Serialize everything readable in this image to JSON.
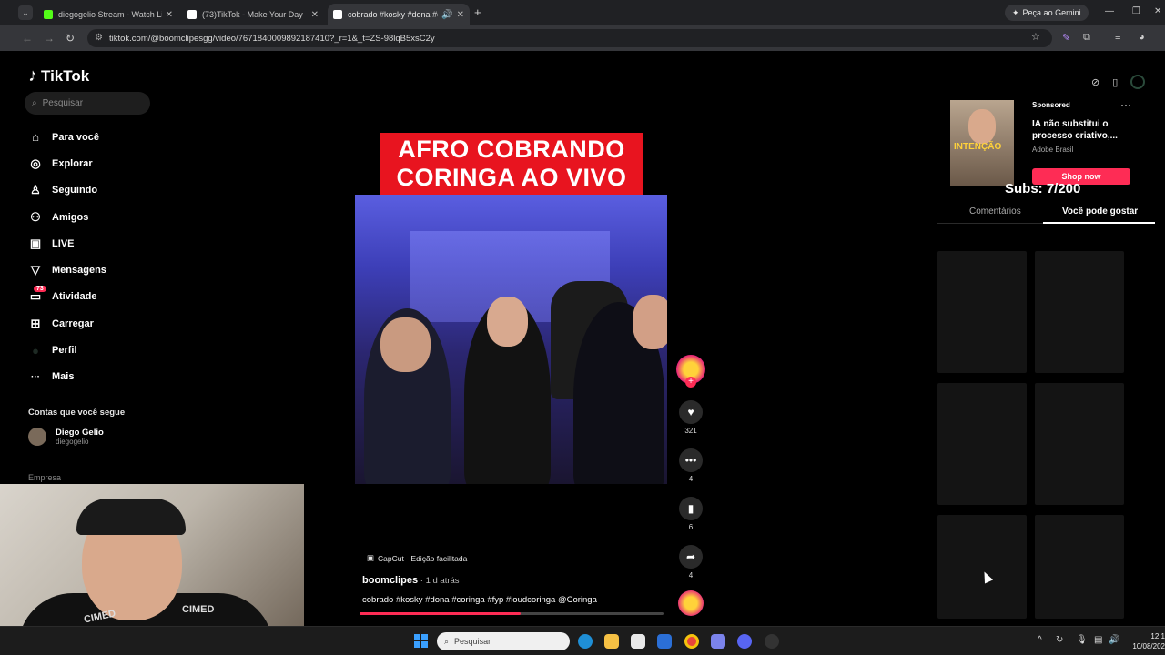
{
  "browser": {
    "tabs": [
      {
        "label": "diegogelio Stream - Watch Live",
        "color": "#53fc18"
      },
      {
        "label": "(73)TikTok - Make Your Day",
        "color": "#ffffff"
      },
      {
        "label": "cobrado #kosky #dona #co",
        "color": "#ffffff"
      }
    ],
    "gemini_label": "Peça ao Gemini",
    "url": "tiktok.com/@boomclipesgg/video/7671840009892187410?_r=1&_t=ZS-98lqB5xsC2y"
  },
  "sidebar": {
    "logo_text": "TikTok",
    "search_placeholder": "Pesquisar",
    "nav": [
      {
        "label": "Para você",
        "icon": "home-icon",
        "glyph": "⌂"
      },
      {
        "label": "Explorar",
        "icon": "compass-icon",
        "glyph": "◎"
      },
      {
        "label": "Seguindo",
        "icon": "following-icon",
        "glyph": "♙"
      },
      {
        "label": "Amigos",
        "icon": "friends-icon",
        "glyph": "⚇"
      },
      {
        "label": "LIVE",
        "icon": "live-icon",
        "glyph": "▣"
      },
      {
        "label": "Mensagens",
        "icon": "messages-icon",
        "glyph": "▽"
      },
      {
        "label": "Atividade",
        "icon": "activity-icon",
        "glyph": "▭",
        "badge": "73"
      },
      {
        "label": "Carregar",
        "icon": "upload-icon",
        "glyph": "⊞"
      },
      {
        "label": "Perfil",
        "icon": "profile-icon",
        "glyph": "●"
      },
      {
        "label": "Mais",
        "icon": "more-icon",
        "glyph": "···"
      }
    ],
    "following_heading": "Contas que você segue",
    "following_account": {
      "name": "Diego Gelio",
      "handle": "diegogelio"
    },
    "company_label": "Empresa"
  },
  "webcam": {
    "shirt_text_left": "CIMED",
    "shirt_text_right": "CIMED"
  },
  "video": {
    "title_line1": "AFRO COBRANDO",
    "title_line2": "CORINGA AO VIVO",
    "capcut_label": "CapCut · Edição facilitada",
    "author": "boomclipes",
    "posted": " · 1 d atrás",
    "description": "cobrado #kosky #dona #coringa #fyp #loudcoringa @Coringa",
    "progress": 0.53
  },
  "actions": {
    "likes": "321",
    "comments": "4",
    "saves": "6",
    "shares": "4"
  },
  "right_panel": {
    "ad": {
      "thumb_tag": "INTENÇÃO",
      "sponsored": "Sponsored",
      "title": "IA não substitui o processo criativo,...",
      "brand": "Adobe Brasil",
      "cta": "Shop now"
    },
    "subs_overlay": "Subs: 7/200",
    "tabs": [
      "Comentários",
      "Você pode gostar"
    ]
  },
  "taskbar": {
    "search_placeholder": "Pesquisar",
    "time": "12:1",
    "date": "10/08/202"
  },
  "colors": {
    "accent": "#fe2c55",
    "title_red": "#e8141f"
  }
}
